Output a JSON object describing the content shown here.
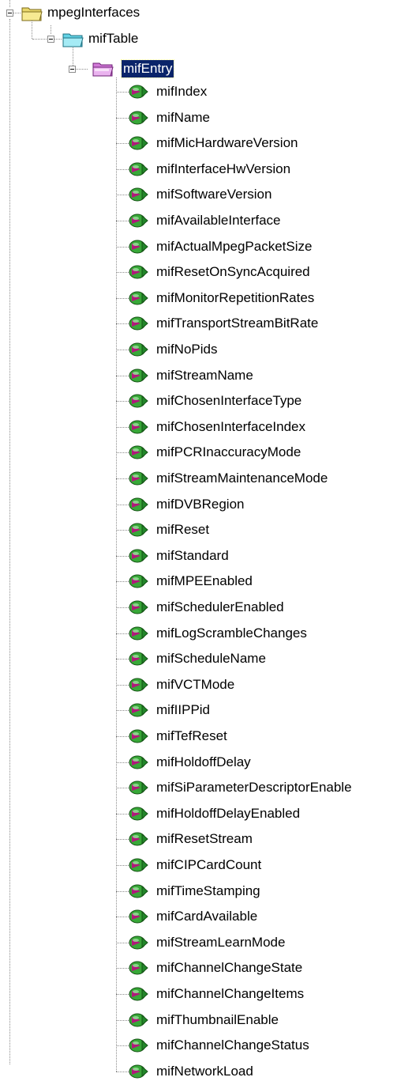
{
  "tree": {
    "root": {
      "label": "mpegInterfaces",
      "icon": "folder-open-yellow-icon",
      "expanded": true
    },
    "table": {
      "label": "mifTable",
      "icon": "folder-open-cyan-icon",
      "expanded": true
    },
    "entry": {
      "label": "mifEntry",
      "icon": "folder-open-magenta-icon",
      "expanded": true,
      "selected": true
    },
    "leaf_icon": "mib-leaf-object-icon",
    "leaves": [
      "mifIndex",
      "mifName",
      "mifMicHardwareVersion",
      "mifInterfaceHwVersion",
      "mifSoftwareVersion",
      "mifAvailableInterface",
      "mifActualMpegPacketSize",
      "mifResetOnSyncAcquired",
      "mifMonitorRepetitionRates",
      "mifTransportStreamBitRate",
      "mifNoPids",
      "mifStreamName",
      "mifChosenInterfaceType",
      "mifChosenInterfaceIndex",
      "mifPCRInaccuracyMode",
      "mifStreamMaintenanceMode",
      "mifDVBRegion",
      "mifReset",
      "mifStandard",
      "mifMPEEnabled",
      "mifSchedulerEnabled",
      "mifLogScrambleChanges",
      "mifScheduleName",
      "mifVCTMode",
      "mifIIPPid",
      "mifTefReset",
      "mifHoldoffDelay",
      "mifSiParameterDescriptorEnable",
      "mifHoldoffDelayEnabled",
      "mifResetStream",
      "mifCIPCardCount",
      "mifTimeStamping",
      "mifCardAvailable",
      "mifStreamLearnMode",
      "mifChannelChangeState",
      "mifChannelChangeItems",
      "mifThumbnailEnable",
      "mifChannelChangeStatus",
      "mifNetworkLoad"
    ]
  },
  "colors": {
    "selection": "#0a246a",
    "connector": "#8c8c8c",
    "folder_yellow": "#e8d66a",
    "folder_cyan": "#63d3e6",
    "folder_magenta": "#d27ad8",
    "leaf_green": "#38a838",
    "leaf_magenta": "#b0197a"
  }
}
